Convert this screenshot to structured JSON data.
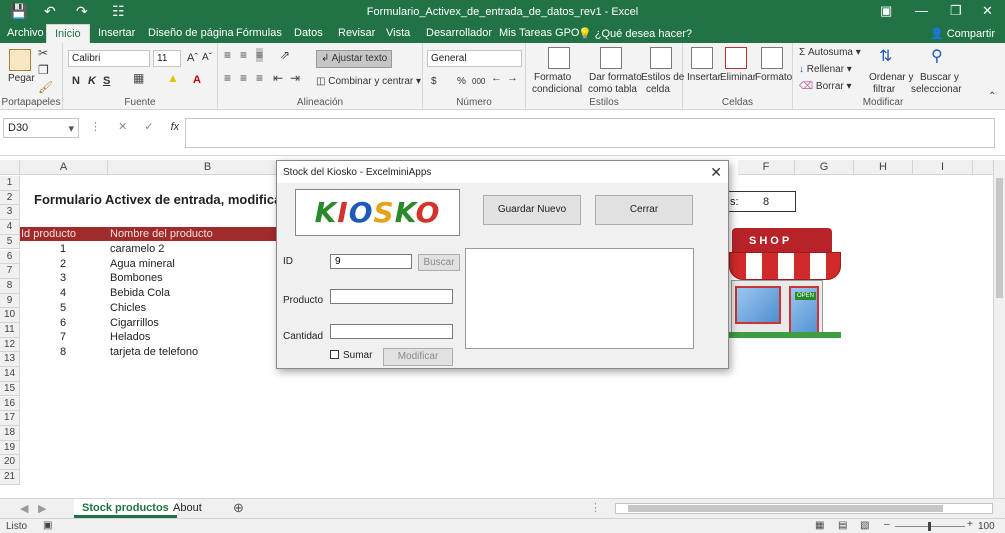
{
  "window": {
    "title": "Formulario_Activex_de_entrada_de_datos_rev1  -  Excel",
    "quick_access": {
      "save": "save-icon",
      "undo": "undo-icon",
      "redo": "redo-icon",
      "preview": "print-preview-icon"
    }
  },
  "menu": {
    "tabs": [
      "Archivo",
      "Inicio",
      "Insertar",
      "Diseño de página",
      "Fórmulas",
      "Datos",
      "Revisar",
      "Vista",
      "Desarrollador",
      "Mis Tareas GPO"
    ],
    "tell_me": "¿Qué desea hacer?",
    "share": "Compartir"
  },
  "ribbon": {
    "paste": "Pegar",
    "font_name": "Calibri",
    "font_size": "11",
    "bold": "N",
    "italic": "K",
    "underline": "S",
    "wrap_text": "Ajustar texto",
    "merge_center": "Combinar y centrar",
    "number_format": "General",
    "currency": "$",
    "percent": "%",
    "thousands": "000",
    "conditional_format": [
      "Formato",
      "condicional"
    ],
    "format_table": [
      "Dar formato",
      "como tabla"
    ],
    "cell_styles": [
      "Estilos de",
      "celda"
    ],
    "insert": "Insertar",
    "delete": "Eliminar",
    "format": "Formato",
    "autosum": "Autosuma",
    "fill": "Rellenar",
    "clear": "Borrar",
    "sort_filter": [
      "Ordenar y",
      "filtrar"
    ],
    "find_select": [
      "Buscar y",
      "seleccionar"
    ],
    "groups": [
      "Portapapeles",
      "Fuente",
      "Alineación",
      "Número",
      "Estilos",
      "Celdas",
      "Modificar"
    ]
  },
  "formula_bar": {
    "name_box": "D30",
    "fx": "fx",
    "formula": ""
  },
  "columns": [
    "A",
    "B",
    "F",
    "G",
    "H",
    "I"
  ],
  "rows": [
    "1",
    "2",
    "3",
    "4",
    "5",
    "6",
    "7",
    "8",
    "9",
    "10",
    "11",
    "12",
    "13",
    "14",
    "15",
    "16",
    "17",
    "18",
    "19",
    "20",
    "21"
  ],
  "sheet": {
    "title": "Formulario Activex de entrada, modificaci",
    "header_id": "Id producto",
    "header_name": "Nombre del producto",
    "products": [
      {
        "id": "1",
        "name": "caramelo 2"
      },
      {
        "id": "2",
        "name": "Agua mineral"
      },
      {
        "id": "3",
        "name": "Bombones"
      },
      {
        "id": "4",
        "name": "Bebida Cola"
      },
      {
        "id": "5",
        "name": "Chicles"
      },
      {
        "id": "6",
        "name": "Cigarrillos"
      },
      {
        "id": "7",
        "name": "Helados"
      },
      {
        "id": "8",
        "name": "tarjeta de telefono"
      }
    ],
    "count_label": "s:",
    "count_value": "8",
    "shop_sign": "SHOP",
    "shop_open": "OPEN"
  },
  "sheet_tabs": [
    "Stock productos",
    "About"
  ],
  "status": {
    "ready": "Listo",
    "zoom": "100 %"
  },
  "dialog": {
    "title": "Stock del Kiosko  - ExcelminiApps",
    "logo_text": "KIOSKO",
    "logo_colors": [
      "#2a8a2a",
      "#d0342c",
      "#1e5bb8",
      "#e6a21a",
      "#2a8a2a",
      "#d0342c"
    ],
    "save_new": "Guardar Nuevo",
    "close": "Cerrar",
    "id_label": "ID",
    "id_value": "9",
    "search": "Buscar",
    "product_label": "Producto",
    "product_value": "",
    "quantity_label": "Cantidad",
    "quantity_value": "",
    "sum_label": "Sumar",
    "modify": "Modificar"
  }
}
